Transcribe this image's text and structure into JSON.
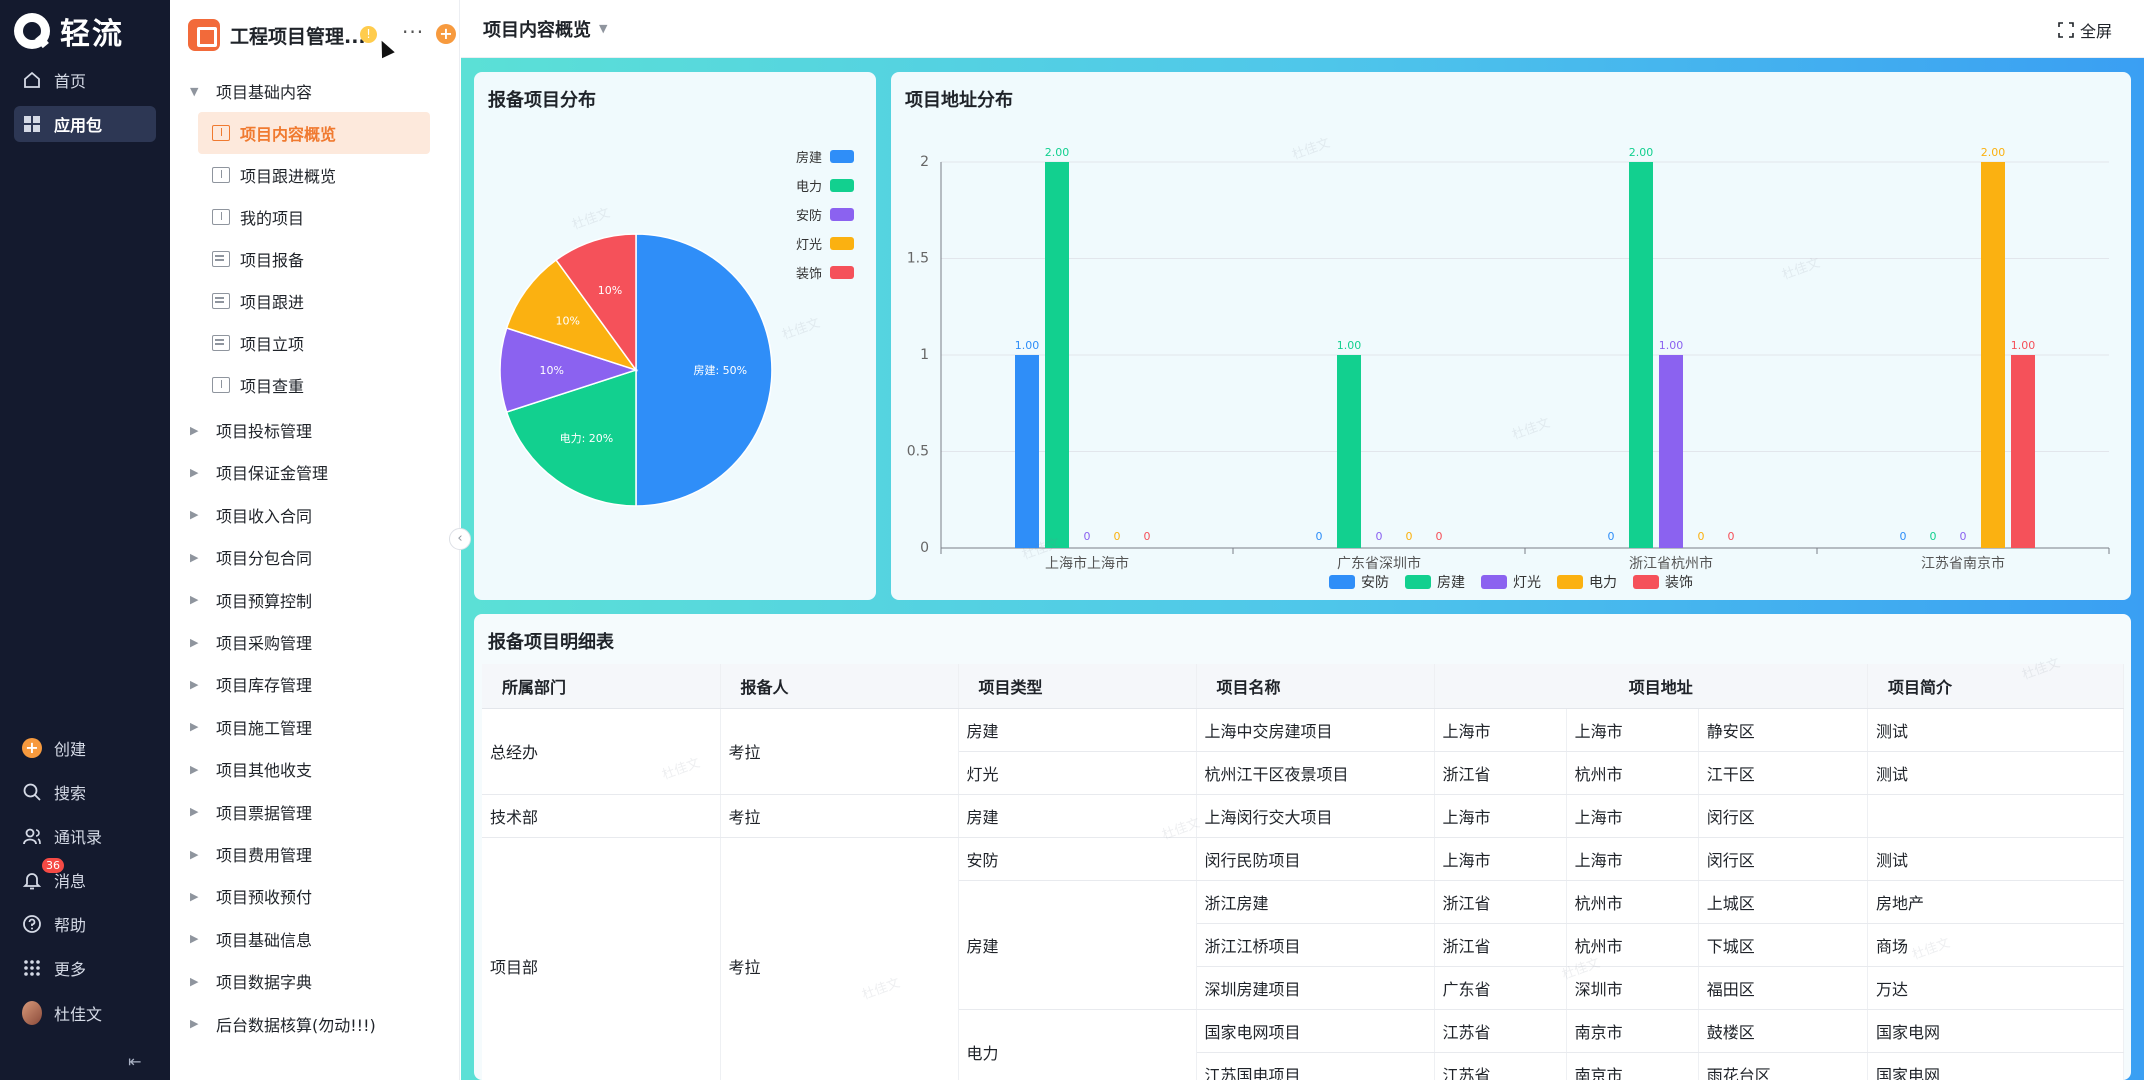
{
  "nav": {
    "brand": "轻流",
    "items_top": [
      {
        "label": "首页",
        "icon": "home-icon"
      },
      {
        "label": "应用包",
        "icon": "grid-icon"
      }
    ],
    "items_bottom": [
      {
        "label": "创建",
        "icon": "plus-circle-icon"
      },
      {
        "label": "搜索",
        "icon": "search-icon"
      },
      {
        "label": "通讯录",
        "icon": "contacts-icon"
      },
      {
        "label": "消息",
        "icon": "bell-icon",
        "badge": "36"
      },
      {
        "label": "帮助",
        "icon": "help-icon"
      },
      {
        "label": "更多",
        "icon": "dots-grid-icon"
      },
      {
        "label": "杜佳文",
        "icon": "avatar"
      }
    ],
    "collapse_icon": "⇤"
  },
  "sidebar": {
    "app_name": "工程项目管理...",
    "warn": "!",
    "more": "···",
    "add": "+",
    "group_open": "项目基础内容",
    "leaves": [
      {
        "label": "项目内容概览",
        "icon": "dashboard-icon",
        "selected": true
      },
      {
        "label": "项目跟进概览",
        "icon": "dashboard-icon"
      },
      {
        "label": "我的项目",
        "icon": "dashboard-icon"
      },
      {
        "label": "项目报备",
        "icon": "form-icon"
      },
      {
        "label": "项目跟进",
        "icon": "form-icon"
      },
      {
        "label": "项目立项",
        "icon": "form-icon"
      },
      {
        "label": "项目查重",
        "icon": "dashboard-icon"
      }
    ],
    "groups": [
      "项目投标管理",
      "项目保证金管理",
      "项目收入合同",
      "项目分包合同",
      "项目预算控制",
      "项目采购管理",
      "项目库存管理",
      "项目施工管理",
      "项目其他收支",
      "项目票据管理",
      "项目费用管理",
      "项目预收预付",
      "项目基础信息",
      "项目数据字典",
      "后台数据核算(勿动!!!)"
    ]
  },
  "header": {
    "title": "项目内容概览",
    "fullscreen": "全屏"
  },
  "watermark": "杜佳文",
  "pie": {
    "title": "报备项目分布"
  },
  "bars": {
    "title": "项目地址分布"
  },
  "table": {
    "title": "报备项目明细表"
  },
  "chart_data": [
    {
      "type": "pie",
      "title": "报备项目分布",
      "slices": [
        {
          "name": "房建",
          "value": 50,
          "label": "房建: 50%",
          "color": "#2f8ef8"
        },
        {
          "name": "电力",
          "value": 20,
          "label": "电力: 20%",
          "color": "#12d08f"
        },
        {
          "name": "安防",
          "value": 10,
          "label": "10%",
          "color": "#8b62f0"
        },
        {
          "name": "灯光",
          "value": 10,
          "label": "10%",
          "color": "#fbb111"
        },
        {
          "name": "装饰",
          "value": 10,
          "label": "10%",
          "color": "#f5515a"
        }
      ],
      "legend": [
        {
          "name": "房建",
          "color": "#2f8ef8"
        },
        {
          "name": "电力",
          "color": "#12d08f"
        },
        {
          "name": "安防",
          "color": "#8b62f0"
        },
        {
          "name": "灯光",
          "color": "#fbb111"
        },
        {
          "name": "装饰",
          "color": "#f5515a"
        }
      ],
      "legend_position": "top-right"
    },
    {
      "type": "bar",
      "title": "项目地址分布",
      "categories": [
        "上海市上海市",
        "广东省深圳市",
        "浙江省杭州市",
        "江苏省南京市"
      ],
      "series": [
        {
          "name": "安防",
          "color": "#2f8ef8",
          "values": [
            1,
            0,
            0,
            0
          ],
          "labels": [
            "1.00",
            "0",
            "0",
            "0"
          ]
        },
        {
          "name": "房建",
          "color": "#12d08f",
          "values": [
            2,
            1,
            2,
            0
          ],
          "labels": [
            "2.00",
            "1.00",
            "2.00",
            "0"
          ]
        },
        {
          "name": "灯光",
          "color": "#8b62f0",
          "values": [
            0,
            0,
            1,
            0
          ],
          "labels": [
            "0",
            "0",
            "1.00",
            "0"
          ]
        },
        {
          "name": "电力",
          "color": "#fbb111",
          "values": [
            0,
            0,
            0,
            2
          ],
          "labels": [
            "0",
            "0",
            "0",
            "2.00"
          ]
        },
        {
          "name": "装饰",
          "color": "#f5515a",
          "values": [
            0,
            0,
            0,
            1
          ],
          "labels": [
            "0",
            "0",
            "0",
            "1.00"
          ]
        }
      ],
      "yticks": [
        "0",
        "0.5",
        "1",
        "1.5",
        "2"
      ],
      "ylim": [
        0,
        2
      ],
      "grid": true,
      "legend_position": "bottom"
    },
    {
      "type": "table",
      "title": "报备项目明细表",
      "headers": [
        "所属部门",
        "报备人",
        "项目类型",
        "项目名称",
        "项目地址",
        "项目简介"
      ],
      "rows": [
        {
          "dept": "总经办",
          "person": "考拉",
          "type": "房建",
          "name": "上海中交房建项目",
          "prov": "上海市",
          "city": "上海市",
          "dist": "静安区",
          "intro": "测试"
        },
        {
          "dept": "",
          "person": "",
          "type": "灯光",
          "name": "杭州江干区夜景项目",
          "prov": "浙江省",
          "city": "杭州市",
          "dist": "江干区",
          "intro": "测试"
        },
        {
          "dept": "技术部",
          "person": "考拉",
          "type": "房建",
          "name": "上海闵行交大项目",
          "prov": "上海市",
          "city": "上海市",
          "dist": "闵行区",
          "intro": ""
        },
        {
          "dept": "项目部",
          "person": "考拉",
          "type": "安防",
          "name": "闵行民防项目",
          "prov": "上海市",
          "city": "上海市",
          "dist": "闵行区",
          "intro": "测试"
        },
        {
          "dept": "",
          "person": "",
          "type": "房建",
          "name": "浙江房建",
          "prov": "浙江省",
          "city": "杭州市",
          "dist": "上城区",
          "intro": "房地产"
        },
        {
          "dept": "",
          "person": "",
          "type": "",
          "name": "浙江江桥项目",
          "prov": "浙江省",
          "city": "杭州市",
          "dist": "下城区",
          "intro": "商场"
        },
        {
          "dept": "",
          "person": "",
          "type": "",
          "name": "深圳房建项目",
          "prov": "广东省",
          "city": "深圳市",
          "dist": "福田区",
          "intro": "万达"
        },
        {
          "dept": "",
          "person": "",
          "type": "电力",
          "name": "国家电网项目",
          "prov": "江苏省",
          "city": "南京市",
          "dist": "鼓楼区",
          "intro": "国家电网"
        },
        {
          "dept": "",
          "person": "",
          "type": "",
          "name": "江苏国电项目",
          "prov": "江苏省",
          "city": "南京市",
          "dist": "雨花台区",
          "intro": "国家电网"
        }
      ]
    }
  ]
}
